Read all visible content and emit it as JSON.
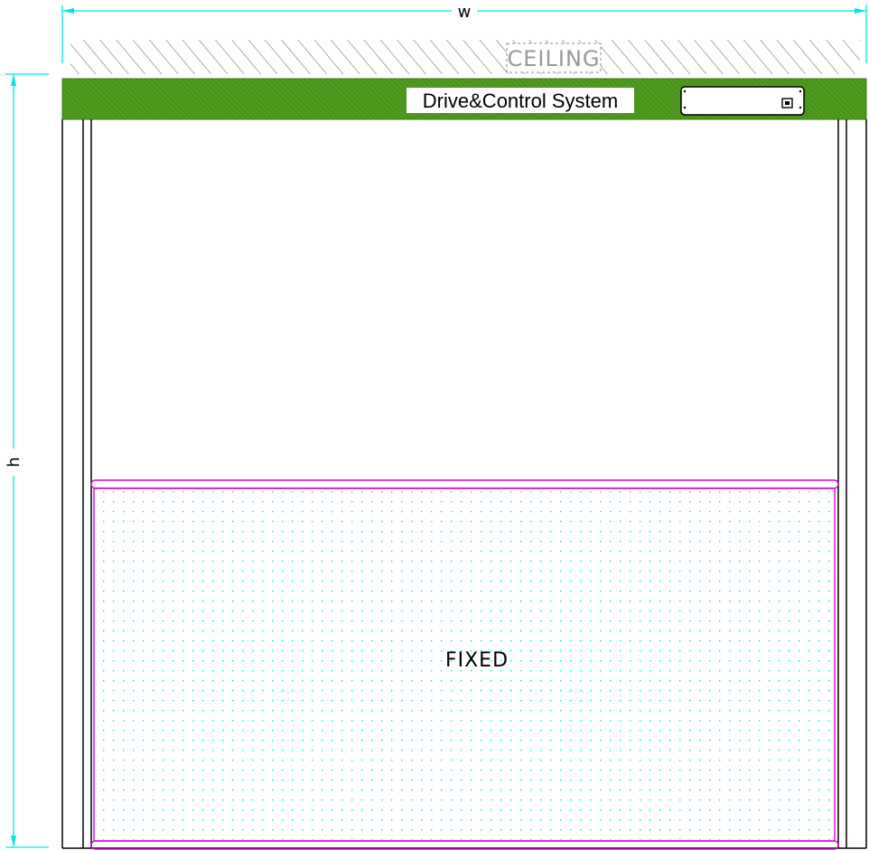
{
  "dimensions": {
    "width_label": "w",
    "height_label": "h"
  },
  "ceiling": {
    "label": "CEILING"
  },
  "drive_system": {
    "label": "Drive&Control System"
  },
  "panel": {
    "label": "FIXED"
  },
  "colors": {
    "dimension_line": "#00e5e5",
    "ceiling_hatch": "#888888",
    "ceiling_text": "#999999",
    "drive_band": "#4e9a1f",
    "drive_band_hatch": "#3d7f12",
    "frame_line": "#000000",
    "fixed_panel_border": "#e000e0",
    "fixed_panel_dots": "#00e5e5"
  }
}
